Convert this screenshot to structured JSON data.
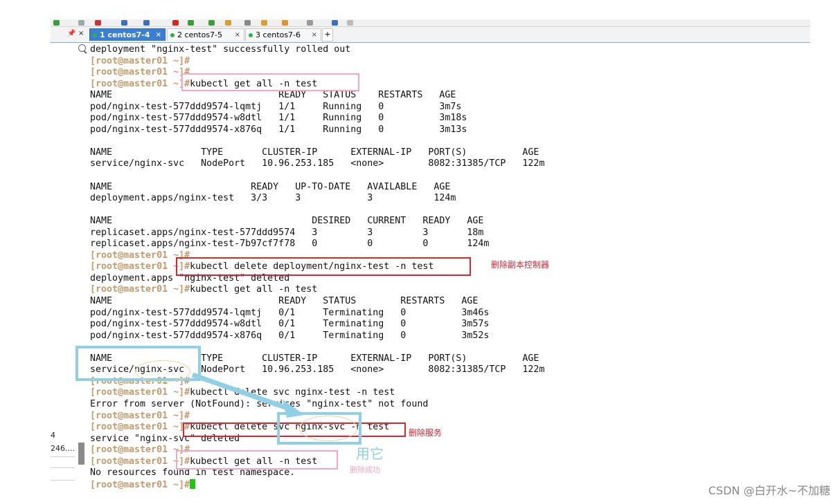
{
  "tabs": [
    {
      "label": "1 centos7-4",
      "active": true
    },
    {
      "label": "2 centos7-5",
      "active": false
    },
    {
      "label": "3 centos7-6",
      "active": false
    }
  ],
  "tab_add": "+",
  "left_panel": {
    "item1": "4",
    "item2": "246...."
  },
  "terminal": {
    "prompt": "[root@master01 ~]#",
    "lines": [
      {
        "p": "",
        "t": "deployment \"nginx-test\" successfully rolled out"
      },
      {
        "p": "[root@master01 ~]#",
        "t": ""
      },
      {
        "p": "[root@master01 ~]#",
        "t": ""
      },
      {
        "p": "[root@master01 ~]#",
        "t": "kubectl get all -n test"
      },
      {
        "p": "",
        "t": "NAME                              READY   STATUS    RESTARTS   AGE"
      },
      {
        "p": "",
        "t": "pod/nginx-test-577ddd9574-lqmtj   1/1     Running   0          3m7s"
      },
      {
        "p": "",
        "t": "pod/nginx-test-577ddd9574-w8dtl   1/1     Running   0          3m18s"
      },
      {
        "p": "",
        "t": "pod/nginx-test-577ddd9574-x876q   1/1     Running   0          3m13s"
      },
      {
        "p": "",
        "t": ""
      },
      {
        "p": "",
        "t": "NAME                TYPE       CLUSTER-IP      EXTERNAL-IP   PORT(S)          AGE"
      },
      {
        "p": "",
        "t": "service/nginx-svc   NodePort   10.96.253.185   <none>        8082:31385/TCP   122m"
      },
      {
        "p": "",
        "t": ""
      },
      {
        "p": "",
        "t": "NAME                         READY   UP-TO-DATE   AVAILABLE   AGE"
      },
      {
        "p": "",
        "t": "deployment.apps/nginx-test   3/3     3            3           124m"
      },
      {
        "p": "",
        "t": ""
      },
      {
        "p": "",
        "t": "NAME                                    DESIRED   CURRENT   READY   AGE"
      },
      {
        "p": "",
        "t": "replicaset.apps/nginx-test-577ddd9574   3         3         3       18m"
      },
      {
        "p": "",
        "t": "replicaset.apps/nginx-test-7b97cf7f78   0         0         0       124m"
      },
      {
        "p": "[root@master01 ~]#",
        "t": ""
      },
      {
        "p": "[root@master01 ~]#",
        "t": "kubectl delete deployment/nginx-test -n test"
      },
      {
        "p": "",
        "t": "deployment.apps \"nginx-test\" deleted"
      },
      {
        "p": "[root@master01 ~]#",
        "t": "kubectl get all -n test"
      },
      {
        "p": "",
        "t": "NAME                              READY   STATUS        RESTARTS   AGE"
      },
      {
        "p": "",
        "t": "pod/nginx-test-577ddd9574-lqmtj   0/1     Terminating   0          3m46s"
      },
      {
        "p": "",
        "t": "pod/nginx-test-577ddd9574-w8dtl   0/1     Terminating   0          3m57s"
      },
      {
        "p": "",
        "t": "pod/nginx-test-577ddd9574-x876q   0/1     Terminating   0          3m52s"
      },
      {
        "p": "",
        "t": ""
      },
      {
        "p": "",
        "t": "NAME                TYPE       CLUSTER-IP      EXTERNAL-IP   PORT(S)          AGE"
      },
      {
        "p": "",
        "t": "service/nginx-svc   NodePort   10.96.253.185   <none>        8082:31385/TCP   122m"
      },
      {
        "p": "[root@master01 ~]#",
        "t": ""
      },
      {
        "p": "[root@master01 ~]#",
        "t": "kubectl delete svc nginx-test -n test"
      },
      {
        "p": "",
        "t": "Error from server (NotFound): services \"nginx-test\" not found"
      },
      {
        "p": "[root@master01 ~]#",
        "t": ""
      },
      {
        "p": "[root@master01 ~]#",
        "t": "kubectl delete svc nginx-svc -n test"
      },
      {
        "p": "",
        "t": "service \"nginx-svc\" deleted"
      },
      {
        "p": "[root@master01 ~]#",
        "t": ""
      },
      {
        "p": "[root@master01 ~]#",
        "t": "kubectl get all -n test"
      },
      {
        "p": "",
        "t": "No resources found in test namespace."
      },
      {
        "p": "[root@master01 ~]#",
        "t": ""
      }
    ]
  },
  "annotations": {
    "delete_rc": "删除副本控制器",
    "delete_svc": "删除服务",
    "use_it": "用它",
    "delete_success": "删除成功"
  },
  "colors": {
    "prompt": "#c49a6c",
    "cursor": "#22c50d",
    "active_tab": "#3a7fd5"
  },
  "watermark": "CSDN @白开水~不加糖"
}
